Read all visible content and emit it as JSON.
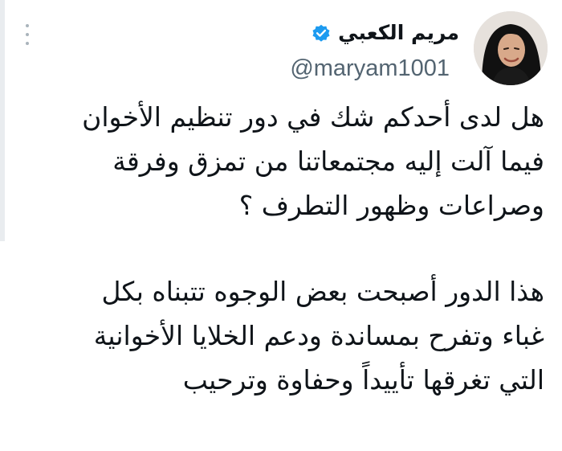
{
  "tweet": {
    "author": {
      "display_name": "مريم الكعبي",
      "handle": "@maryam1001",
      "verified": true,
      "avatar_icon": "profile-photo"
    },
    "paragraphs": [
      {
        "lines": [
          "هل لدى أحدكم شك في دور تنظيم الأخوان",
          "فيما آلت إليه مجتمعاتنا من تمزق وفرقة",
          "وصراعات وظهور التطرف ؟"
        ]
      },
      {
        "lines": [
          "هذا الدور أصبحت بعض الوجوه تتبناه بكل",
          "غباء وتفرح بمساندة ودعم الخلايا الأخوانية",
          "التي تغرقها تأييداً وحفاوة وترحيب"
        ]
      }
    ],
    "more_icon": "more-vertical-icon"
  },
  "colors": {
    "verified_badge": "#1d9bf0",
    "handle_text": "#536471",
    "body_text": "#0f1419"
  }
}
